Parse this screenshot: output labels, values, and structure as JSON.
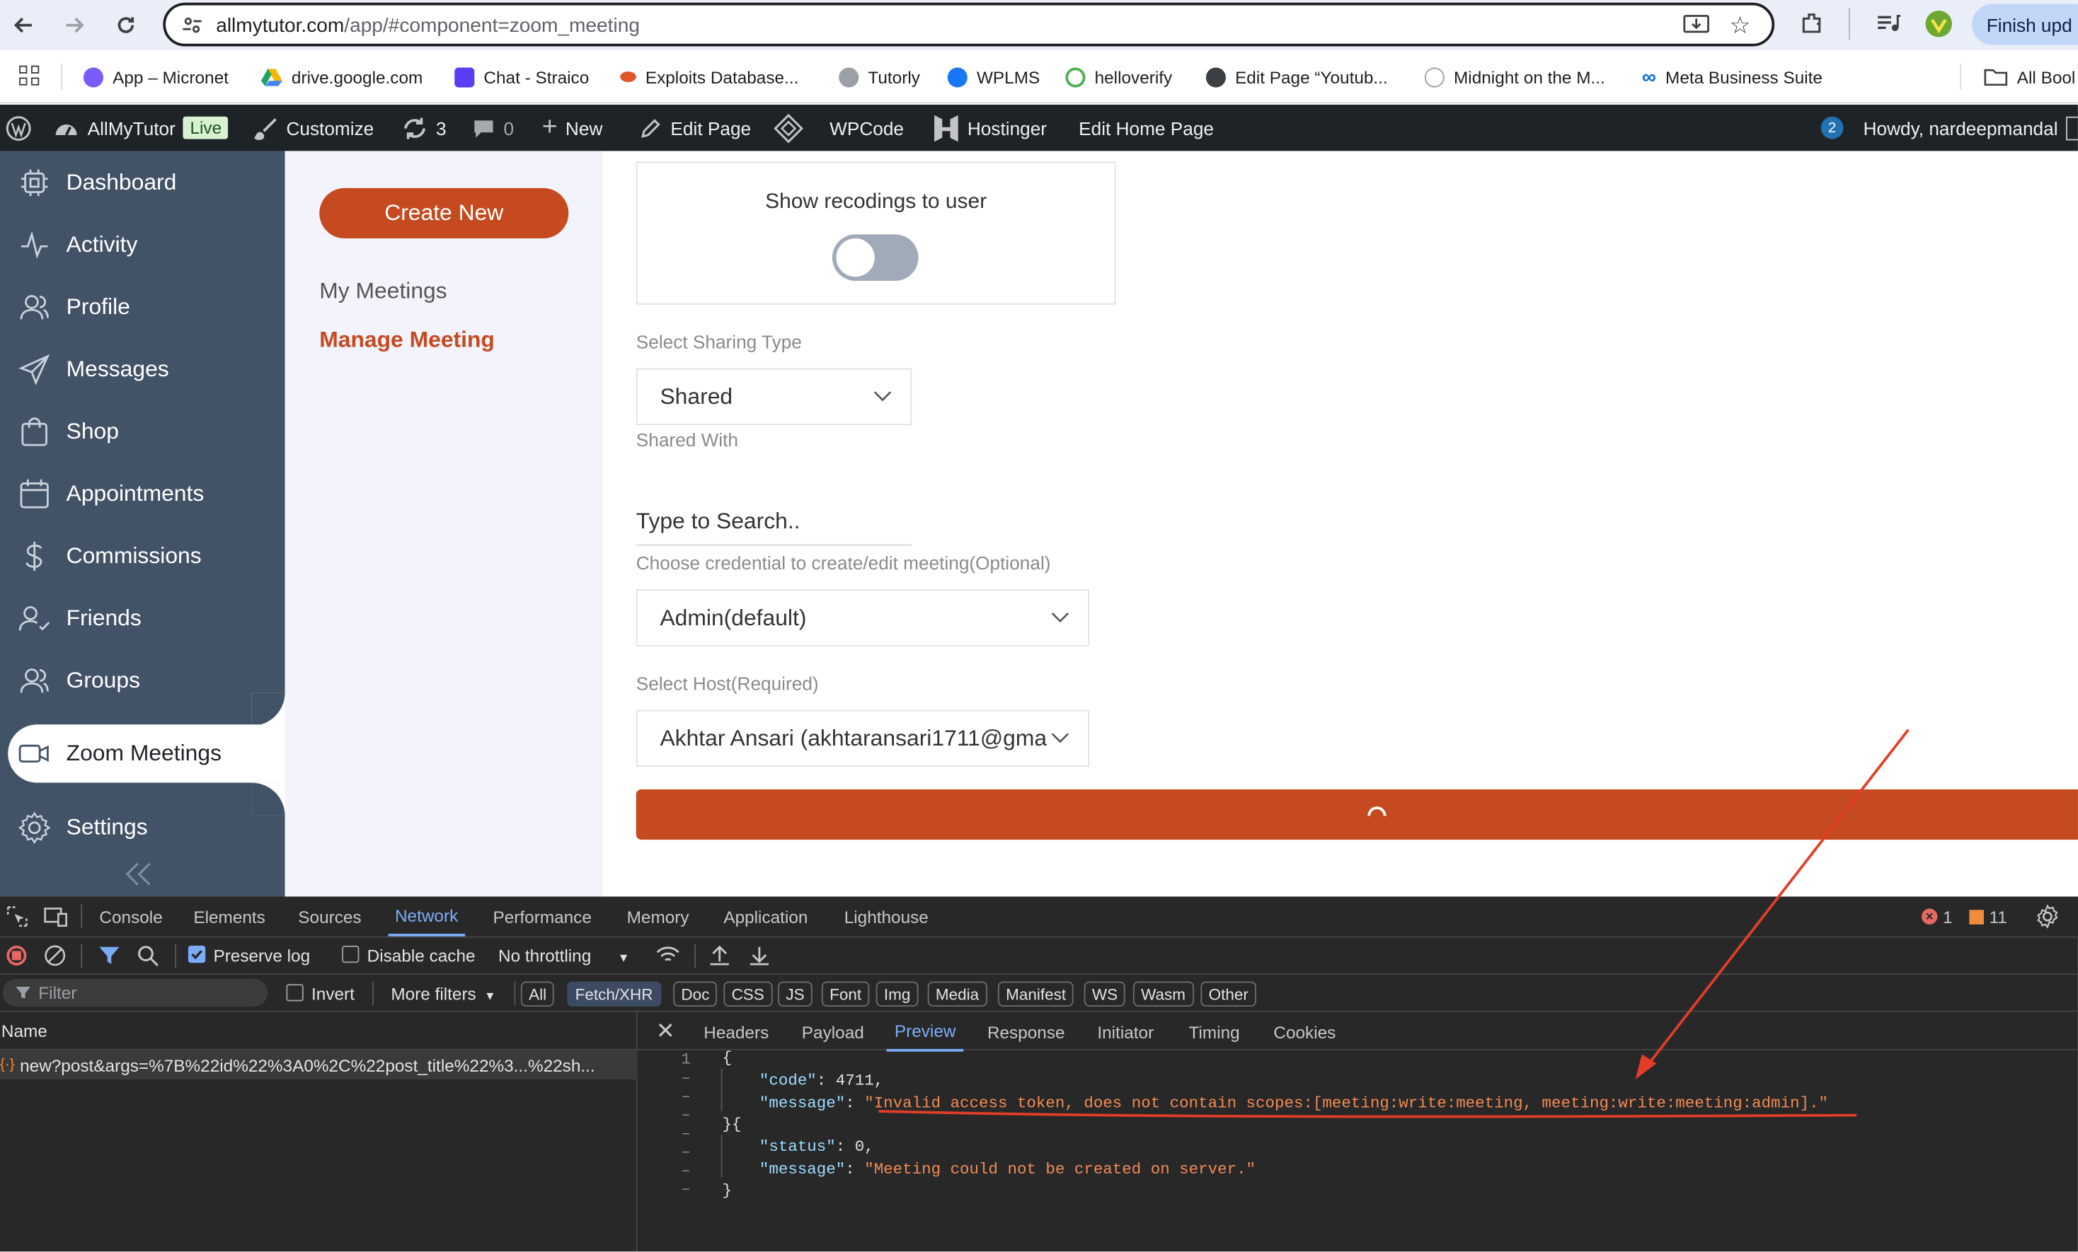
{
  "browser": {
    "url_host": "allmytutor.com",
    "url_path": "/app/#component=zoom_meeting",
    "finish_update_label": "Finish upd",
    "bookmarks": [
      {
        "label": "App – Micronet",
        "color": "#7a5af8"
      },
      {
        "label": "drive.google.com",
        "color": "#1fa463"
      },
      {
        "label": "Chat - Straico",
        "color": "#5b3df5"
      },
      {
        "label": "Exploits Database...",
        "color": "#e2552d"
      },
      {
        "label": "Tutorly",
        "color": "#9aa0a6"
      },
      {
        "label": "WPLMS",
        "color": "#1877f2"
      },
      {
        "label": "helloverify",
        "color": "#4caf50"
      },
      {
        "label": "Edit Page “Youtub...",
        "color": "#3c4043"
      },
      {
        "label": "Midnight on the M...",
        "color": "#9aa0a6"
      },
      {
        "label": "Meta Business Suite",
        "color": "#0668e1"
      },
      {
        "label": "All Bool",
        "color": "#5f6368"
      }
    ]
  },
  "wp_admin_bar": {
    "site_name": "AllMyTutor",
    "live_badge": "Live",
    "customize": "Customize",
    "updates_count": "3",
    "comments_count": "0",
    "new_label": "New",
    "edit_page": "Edit Page",
    "wpcode": "WPCode",
    "hostinger": "Hostinger",
    "edit_home": "Edit Home Page",
    "notif_count": "2",
    "howdy": "Howdy, nardeepmandal"
  },
  "sidebar": {
    "items": [
      {
        "label": "Dashboard",
        "icon": "dashboard-icon"
      },
      {
        "label": "Activity",
        "icon": "activity-icon"
      },
      {
        "label": "Profile",
        "icon": "profile-icon"
      },
      {
        "label": "Messages",
        "icon": "messages-icon"
      },
      {
        "label": "Shop",
        "icon": "shop-icon"
      },
      {
        "label": "Appointments",
        "icon": "calendar-icon"
      },
      {
        "label": "Commissions",
        "icon": "dollar-icon"
      },
      {
        "label": "Friends",
        "icon": "friends-icon"
      },
      {
        "label": "Groups",
        "icon": "groups-icon"
      }
    ],
    "active_item": "Zoom Meetings",
    "settings": "Settings"
  },
  "subnav": {
    "create_new": "Create New",
    "my_meetings": "My Meetings",
    "manage_meeting": "Manage Meeting"
  },
  "form": {
    "show_recordings_label": "Show recodings to user",
    "show_recordings_on": false,
    "sharing_type_label": "Select Sharing Type",
    "sharing_type_value": "Shared",
    "shared_with_label": "Shared With",
    "search_placeholder": "Type to Search..",
    "credential_label": "Choose credential to create/edit meeting(Optional)",
    "credential_value": "Admin(default)",
    "host_label": "Select Host(Required)",
    "host_value": "Akhtar Ansari (akhtaransari1711@gma"
  },
  "devtools": {
    "tabs": [
      "Console",
      "Elements",
      "Sources",
      "Network",
      "Performance",
      "Memory",
      "Application",
      "Lighthouse"
    ],
    "active_tab": "Network",
    "error_count": "1",
    "warning_count": "11",
    "preserve_log": "Preserve log",
    "disable_cache": "Disable cache",
    "throttling": "No throttling",
    "filter_placeholder": "Filter",
    "invert": "Invert",
    "more_filters": "More filters",
    "type_filters": [
      "All",
      "Fetch/XHR",
      "Doc",
      "CSS",
      "JS",
      "Font",
      "Img",
      "Media",
      "Manifest",
      "WS",
      "Wasm",
      "Other"
    ],
    "active_type_filter": "Fetch/XHR",
    "name_header": "Name",
    "request_name": "new?post&args=%7B%22id%22%3A0%2C%22post_title%22%3...%22sh...",
    "detail_tabs": [
      "Headers",
      "Payload",
      "Preview",
      "Response",
      "Initiator",
      "Timing",
      "Cookies"
    ],
    "active_detail_tab": "Preview",
    "preview": {
      "code_key": "\"code\"",
      "code_value": "4711,",
      "message_key": "\"message\"",
      "message_value": "\"Invalid access token, does not contain scopes:[meeting:write:meeting, meeting:write:meeting:admin].\"",
      "status_key": "\"status\"",
      "status_value": "0,",
      "message2_key": "\"message\"",
      "message2_value": "\"Meeting could not be created on server.\""
    }
  },
  "colors": {
    "accent": "#c64a1f",
    "sidebar_bg": "#435367",
    "wp_bar_bg": "#1d2327",
    "annotation_red": "#e23d28"
  }
}
